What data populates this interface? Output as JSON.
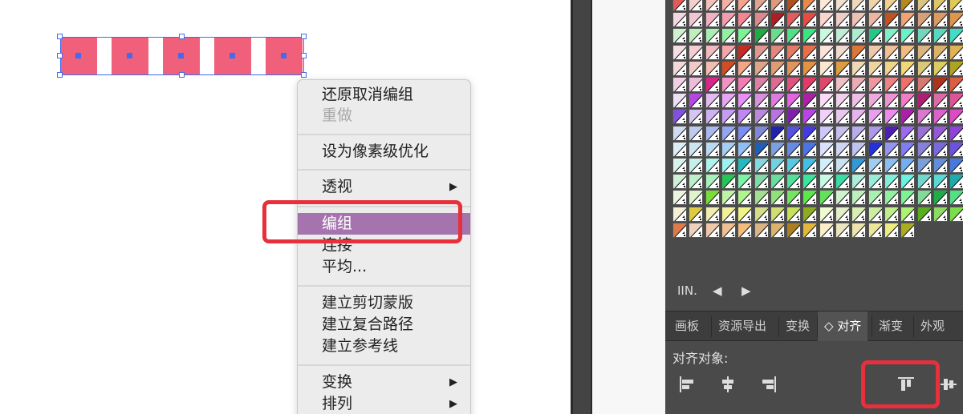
{
  "context_menu": {
    "items": [
      {
        "label": "还原取消编组",
        "state": "normal",
        "submenu": false
      },
      {
        "label": "重做",
        "state": "disabled",
        "submenu": false
      },
      {
        "label": "设为像素级优化",
        "state": "normal",
        "submenu": false
      },
      {
        "label": "透视",
        "state": "normal",
        "submenu": true
      },
      {
        "label": "编组",
        "state": "highlighted",
        "submenu": false
      },
      {
        "label": "连接",
        "state": "normal",
        "submenu": false
      },
      {
        "label": "平均...",
        "state": "normal",
        "submenu": false
      },
      {
        "label": "建立剪切蒙版",
        "state": "normal",
        "submenu": false
      },
      {
        "label": "建立复合路径",
        "state": "normal",
        "submenu": false
      },
      {
        "label": "建立参考线",
        "state": "normal",
        "submenu": false
      },
      {
        "label": "变换",
        "state": "normal",
        "submenu": true
      },
      {
        "label": "排列",
        "state": "normal",
        "submenu": true
      }
    ],
    "submenu_arrow": "▶"
  },
  "selection": {
    "object_count": 5,
    "fill_color": "#f0607a",
    "anchor_color": "#3f6cf3"
  },
  "swatch_panel": {
    "footer_icons": [
      "library-icon",
      "previous-icon",
      "next-icon"
    ],
    "footer_library_label": "IIN.",
    "footer_prev": "◀",
    "footer_next": "▶"
  },
  "panel_tabs": [
    {
      "label": "画板",
      "active": false
    },
    {
      "label": "资源导出",
      "active": false
    },
    {
      "label": "变换",
      "active": false
    },
    {
      "label": "◇ 对齐",
      "active": true
    },
    {
      "label": "渐变",
      "active": false
    },
    {
      "label": "外观",
      "active": false
    }
  ],
  "align_panel": {
    "title": "对齐对象:",
    "buttons": [
      "align-left-icon",
      "align-horizontal-center-icon",
      "align-right-icon",
      "align-top-icon",
      "align-vertical-center-icon"
    ]
  },
  "annotation_color": "#e8303c",
  "highlight_color": "#a574ae"
}
